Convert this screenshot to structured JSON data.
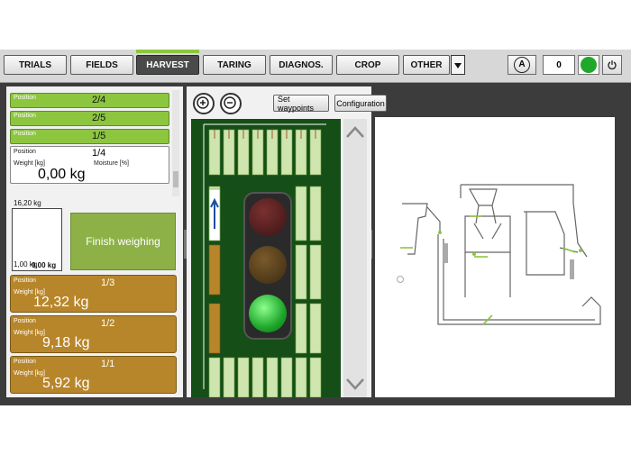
{
  "tabs": [
    {
      "label": "TRIALS",
      "active": false
    },
    {
      "label": "FIELDS",
      "active": false
    },
    {
      "label": "HARVEST",
      "active": true
    },
    {
      "label": "TARING",
      "active": false
    },
    {
      "label": "DIAGNOS.",
      "active": false
    },
    {
      "label": "CROP",
      "active": false
    },
    {
      "label": "OTHER",
      "active": false
    }
  ],
  "header": {
    "auto_label": "A",
    "counter": "0"
  },
  "positions": [
    {
      "key": "Position",
      "value": "2/4"
    },
    {
      "key": "Position",
      "value": "2/5"
    },
    {
      "key": "Position",
      "value": "1/5"
    }
  ],
  "current": {
    "position_label": "Position",
    "position_value": "1/4",
    "weight_label": "Weight [kg]",
    "moisture_label": "Moisture [%]",
    "weight_value": "0,00 kg"
  },
  "gauge": {
    "max": "16,20 kg",
    "min": "1,00 kg",
    "value": "0,00 kg",
    "fill": 0.0
  },
  "finish_label": "Finish weighing",
  "weighed": [
    {
      "position_label": "Position",
      "position_value": "1/3",
      "weight_label": "Weight [kg]",
      "weight": "12,32 kg"
    },
    {
      "position_label": "Position",
      "position_value": "1/2",
      "weight_label": "Weight [kg]",
      "weight": "9,18 kg"
    },
    {
      "position_label": "Position",
      "position_value": "1/1",
      "weight_label": "Weight [kg]",
      "weight": "5,92 kg"
    }
  ],
  "toolbar": {
    "set_waypoints": "Set waypoints",
    "configuration": "Configuration"
  },
  "traffic_light": {
    "active": "green"
  },
  "colors": {
    "accent": "#8cc63f",
    "plot_done": "#b8862a",
    "status": "#1fa82a"
  }
}
